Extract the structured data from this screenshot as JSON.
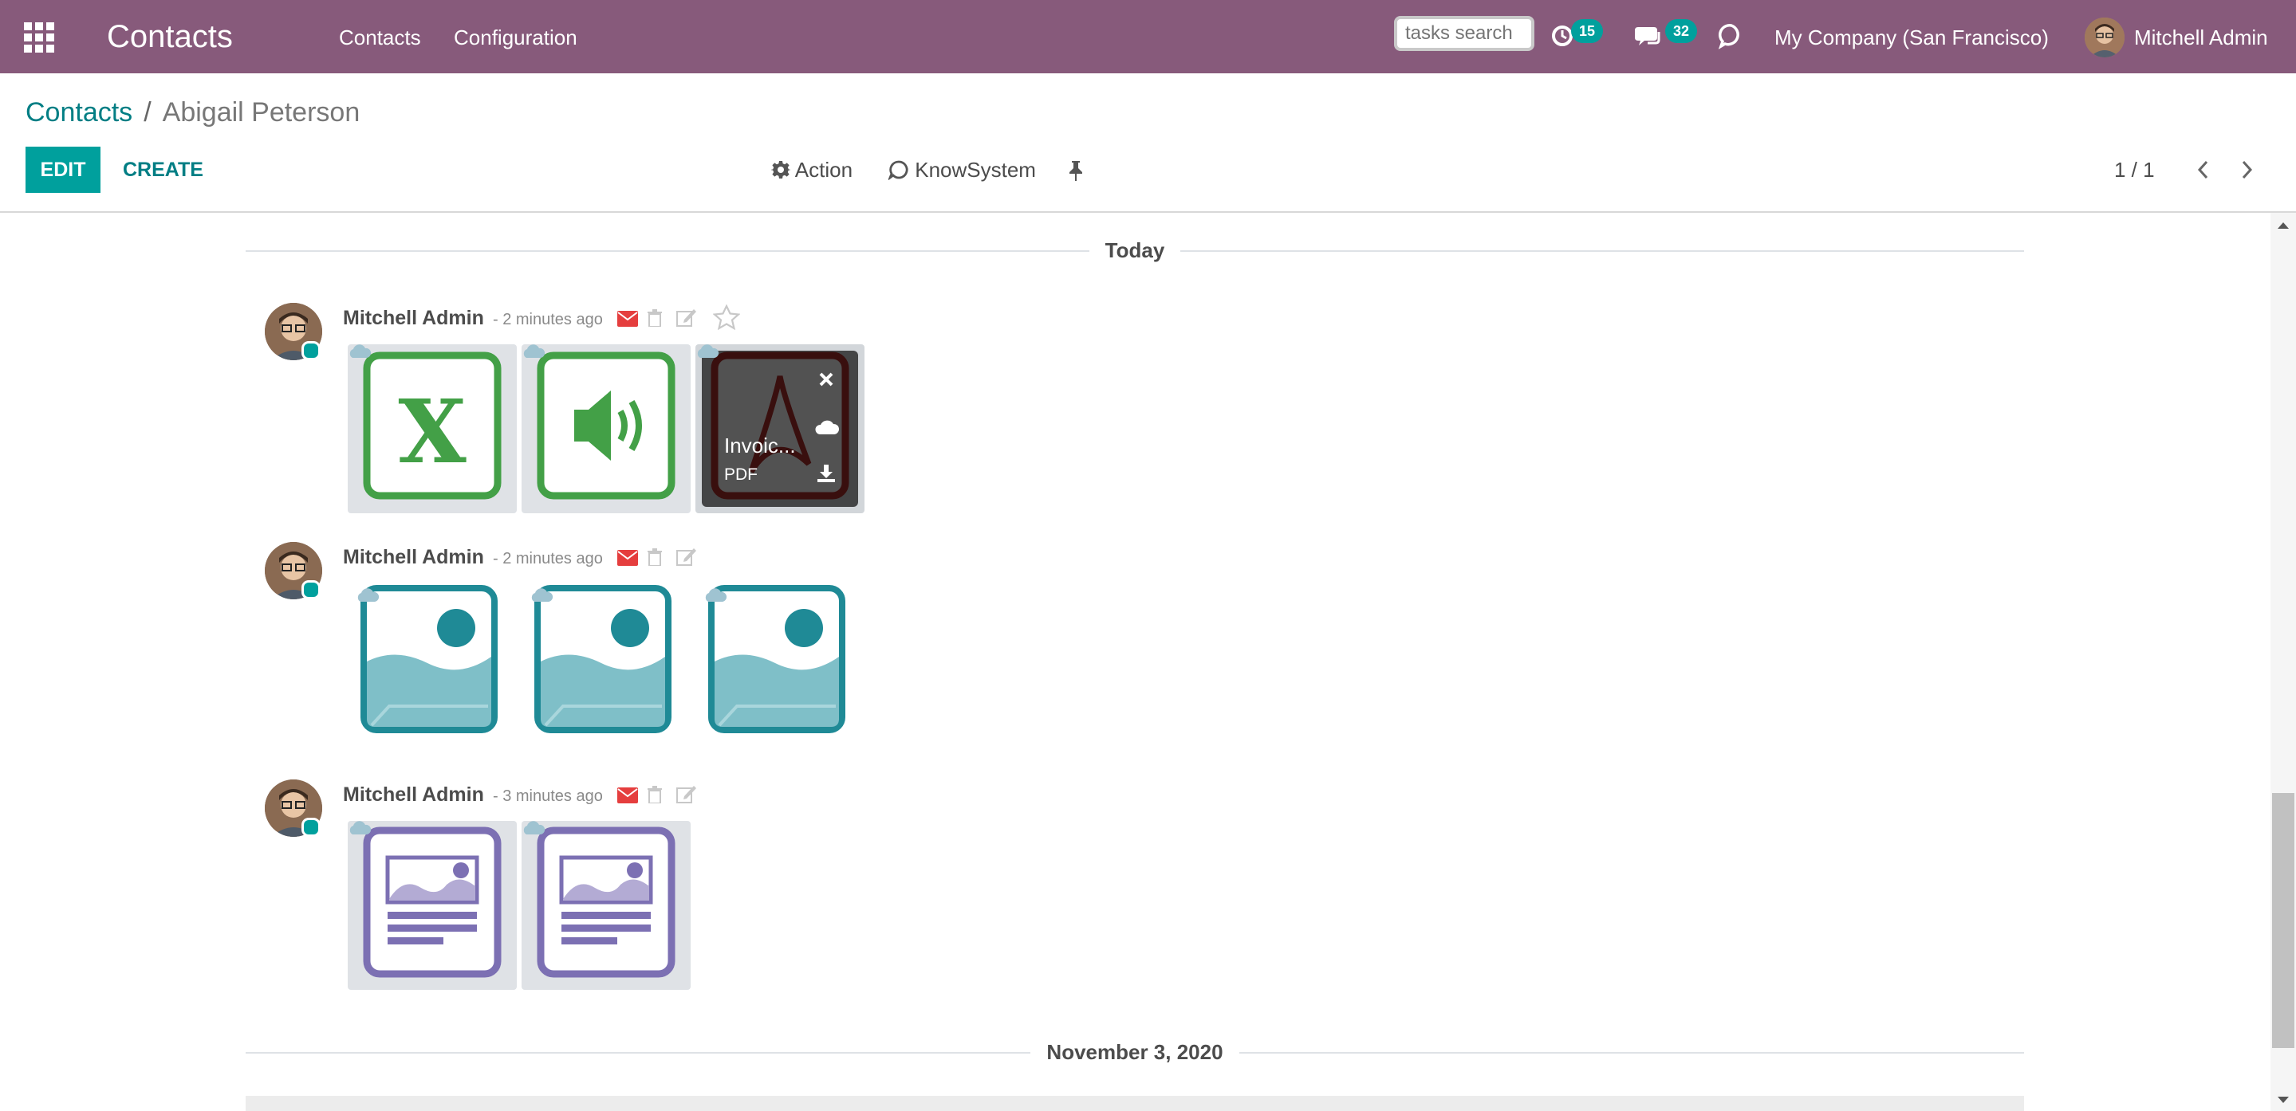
{
  "navbar": {
    "brand": "Contacts",
    "menu": [
      "Contacts",
      "Configuration"
    ],
    "search_placeholder": "tasks search",
    "activity_count": "15",
    "message_count": "32",
    "company": "My Company (San Francisco)",
    "user": "Mitchell Admin",
    "bg_color": "#875a7b",
    "badge_color": "#00a09d"
  },
  "breadcrumb": {
    "parent": "Contacts",
    "separator": "/",
    "current": "Abigail Peterson"
  },
  "control_panel": {
    "edit_label": "EDIT",
    "create_label": "CREATE",
    "action_label": "Action",
    "knowsystem_label": "KnowSystem",
    "pager": "1 / 1"
  },
  "chatter": {
    "separators": [
      "Today",
      "November 3, 2020"
    ],
    "messages": [
      {
        "author": "Mitchell Admin",
        "date": "- 2 minutes ago",
        "attachments": [
          {
            "type": "spreadsheet",
            "icon": "excel-icon"
          },
          {
            "type": "audio",
            "icon": "audio-icon"
          },
          {
            "type": "pdf",
            "icon": "pdf-icon",
            "name": "Invoic...",
            "ext": "PDF"
          }
        ]
      },
      {
        "author": "Mitchell Admin",
        "date": "- 2 minutes ago",
        "attachments": [
          {
            "type": "image",
            "icon": "image-icon"
          },
          {
            "type": "image",
            "icon": "image-icon"
          },
          {
            "type": "image",
            "icon": "image-icon"
          }
        ]
      },
      {
        "author": "Mitchell Admin",
        "date": "- 3 minutes ago",
        "attachments": [
          {
            "type": "document",
            "icon": "document-icon"
          },
          {
            "type": "document",
            "icon": "document-icon"
          }
        ]
      }
    ]
  }
}
